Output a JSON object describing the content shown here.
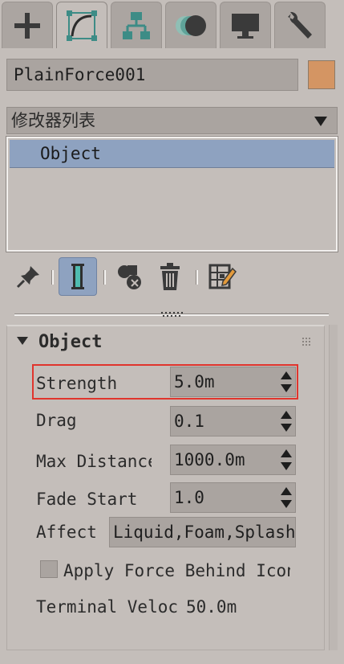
{
  "tabs": [
    {
      "icon": "plus-icon",
      "name": "create"
    },
    {
      "icon": "curve-edit-icon",
      "name": "modify"
    },
    {
      "icon": "hierarchy-icon",
      "name": "hierarchy"
    },
    {
      "icon": "motion-circles-icon",
      "name": "motion"
    },
    {
      "icon": "monitor-icon",
      "name": "display"
    },
    {
      "icon": "wrench-icon",
      "name": "utilities"
    }
  ],
  "object_name": "PlainForce001",
  "object_color": "#d49563",
  "modifier_list_label": "修改器列表",
  "stack_items": [
    "Object"
  ],
  "rollout": {
    "title": "Object",
    "strength_label": "Strength",
    "strength_value": "5.0m",
    "drag_label": "Drag",
    "drag_value": "0.1",
    "max_distance_label": "Max Distance",
    "max_distance_value": "1000.0m",
    "fade_start_label": "Fade Start",
    "fade_start_value": "1.0",
    "affect_label": "Affect",
    "affect_value": "Liquid,Foam,Splash",
    "apply_force_label": "Apply Force Behind Icon",
    "terminal_label": "Terminal Veloc",
    "terminal_value": "50.0m"
  }
}
